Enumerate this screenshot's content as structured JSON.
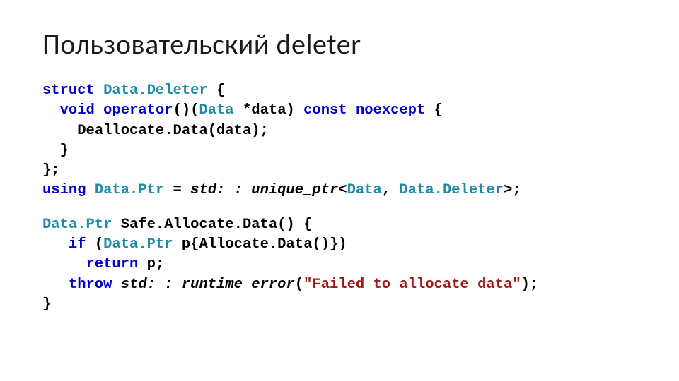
{
  "title": "Пользовательский deleter",
  "code": {
    "l1_kw1": "struct",
    "l1_type": "Data.Deleter",
    "l1_brace": " {",
    "l2_kw1": "void",
    "l2_kw2": "operator",
    "l2_paren": "()(",
    "l2_type": "Data",
    "l2_arg": " *data) ",
    "l2_kw3": "const",
    "l2_sp": " ",
    "l2_kw4": "noexcept",
    "l2_brace": " {",
    "l3_call": "Deallocate.Data(data);",
    "l4_brace": "}",
    "l5_end": "};",
    "l6_kw1": "using",
    "l6_type1": "Data.Ptr",
    "l6_eq": " = ",
    "l6_std": "std: : unique_ptr",
    "l6_lt": "<",
    "l6_t1": "Data",
    "l6_comma": ", ",
    "l6_t2": "Data.Deleter",
    "l6_gt": ">;",
    "l8_type": "Data.Ptr",
    "l8_fn": " Safe.Allocate.Data() {",
    "l9_kw": "if",
    "l9_openp": " (",
    "l9_type": "Data.Ptr",
    "l9_rest": " p{Allocate.Data()})",
    "l10_kw": "return",
    "l10_rest": " p;",
    "l11_kw": "throw",
    "l11_sp": " ",
    "l11_std": "std: : runtime_error",
    "l11_openp": "(",
    "l11_str": "\"Failed to allocate data\"",
    "l11_closep": ");",
    "l12_brace": "}"
  }
}
